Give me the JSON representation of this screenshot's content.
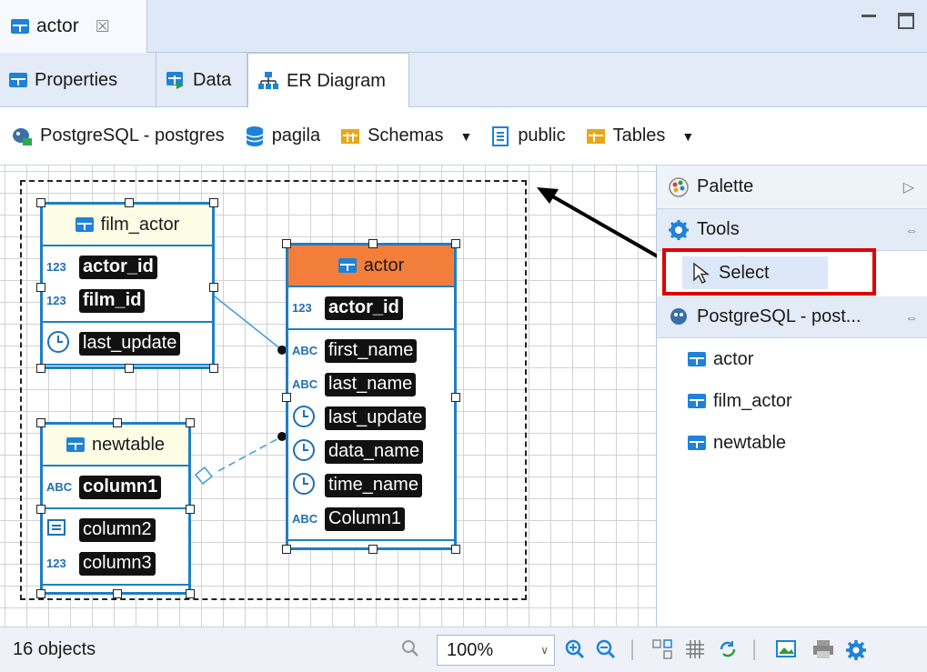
{
  "editor_tab": {
    "label": "actor",
    "close_glyph": "☒"
  },
  "subtabs": [
    {
      "label": "Properties"
    },
    {
      "label": "Data"
    },
    {
      "label": "ER Diagram"
    }
  ],
  "toolbar": {
    "connection": "PostgreSQL - postgres",
    "database": "pagila",
    "schemas": "Schemas",
    "schema": "public",
    "tables": "Tables"
  },
  "entities": {
    "film_actor": {
      "title": "film_actor",
      "keys": [
        {
          "type": "123",
          "name": "actor_id"
        },
        {
          "type": "123",
          "name": "film_id"
        }
      ],
      "attrs": [
        {
          "type": "time",
          "name": "last_update"
        }
      ]
    },
    "actor": {
      "title": "actor",
      "keys": [
        {
          "type": "123",
          "name": "actor_id"
        }
      ],
      "attrs": [
        {
          "type": "ABC",
          "name": "first_name"
        },
        {
          "type": "ABC",
          "name": "last_name"
        },
        {
          "type": "time",
          "name": "last_update"
        },
        {
          "type": "time",
          "name": "data_name"
        },
        {
          "type": "time",
          "name": "time_name"
        },
        {
          "type": "ABC",
          "name": "Column1"
        }
      ]
    },
    "newtable": {
      "title": "newtable",
      "keys": [
        {
          "type": "ABC",
          "name": "column1"
        }
      ],
      "attrs": [
        {
          "type": "text",
          "name": "column2"
        },
        {
          "type": "123",
          "name": "column3"
        }
      ]
    }
  },
  "palette": {
    "title": "Palette",
    "tools_label": "Tools",
    "select_label": "Select",
    "connection_group": "PostgreSQL - post...",
    "tables": [
      "actor",
      "film_actor",
      "newtable"
    ]
  },
  "status": {
    "objects": "16 objects",
    "zoom": "100%"
  },
  "colors": {
    "entity_border": "#1e7fc3",
    "actor_header": "#f37e3c",
    "entity_header": "#fdfde5",
    "highlight_red": "#e00000"
  }
}
